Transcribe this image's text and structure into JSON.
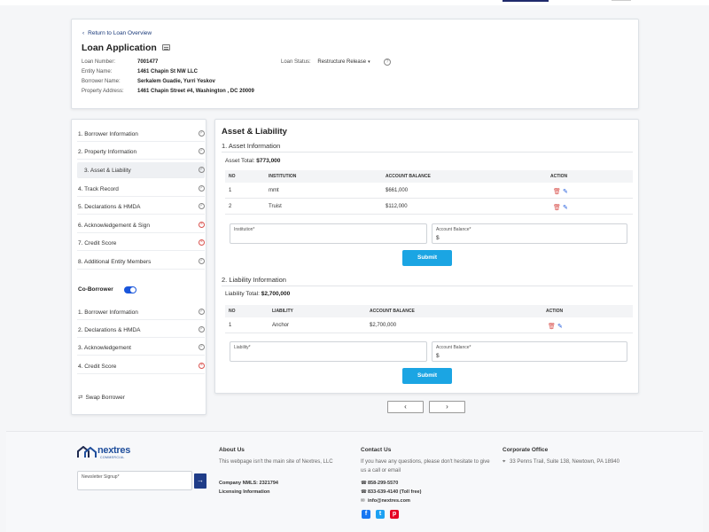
{
  "header": {
    "back_label": "Return to Loan Overview",
    "title": "Loan Application",
    "fields": [
      {
        "label": "Loan Number:",
        "value": "7001477"
      },
      {
        "label": "Entity Name:",
        "value": "1461 Chapin St NW LLC"
      },
      {
        "label": "Borrower Name:",
        "value": "Serkalem Guadie, Yurri Yeskov"
      },
      {
        "label": "Property Address:",
        "value": "1461 Chapin Street #4, Washington , DC 20009"
      }
    ],
    "status_label": "Loan Status:",
    "status_value": "Restructure Release"
  },
  "sidebar": {
    "borrower_steps": [
      {
        "label": "1. Borrower Information",
        "state": "ok"
      },
      {
        "label": "2. Property Information",
        "state": "ok"
      },
      {
        "label": "3. Asset & Liability",
        "state": "ok"
      },
      {
        "label": "4. Track Record",
        "state": "ok"
      },
      {
        "label": "5. Declarations & HMDA",
        "state": "ok"
      },
      {
        "label": "6. Acknowledgement & Sign",
        "state": "err"
      },
      {
        "label": "7. Credit Score",
        "state": "err"
      },
      {
        "label": "8. Additional Entity Members",
        "state": "ok"
      }
    ],
    "coborrower_label": "Co-Borrower",
    "coborrower_steps": [
      {
        "label": "1. Borrower Information",
        "state": "ok"
      },
      {
        "label": "2. Declarations & HMDA",
        "state": "ok"
      },
      {
        "label": "3. Acknowledgement",
        "state": "ok"
      },
      {
        "label": "4. Credit Score",
        "state": "err"
      }
    ],
    "swap_label": "Swap Borrower"
  },
  "main": {
    "title": "Asset & Liability",
    "asset": {
      "title": "1. Asset Information",
      "total_label": "Asset Total:",
      "total_value": "$773,000",
      "columns": [
        "NO",
        "INSTITUTION",
        "ACCOUNT BALANCE",
        "ACTION"
      ],
      "rows": [
        {
          "no": "1",
          "name": "mmt",
          "balance": "$661,000"
        },
        {
          "no": "2",
          "name": "Truist",
          "balance": "$112,000"
        }
      ],
      "field1_label": "Institution*",
      "field2_label": "Account Balance*",
      "field2_value": "$",
      "submit": "Submit"
    },
    "liability": {
      "title": "2. Liability Information",
      "total_label": "Liability Total:",
      "total_value": "$2,700,000",
      "columns": [
        "NO",
        "LIABILITY",
        "ACCOUNT BALANCE",
        "ACTION"
      ],
      "rows": [
        {
          "no": "1",
          "name": "Anchor",
          "balance": "$2,700,000"
        }
      ],
      "field1_label": "Liability*",
      "field2_label": "Account Balance*",
      "field2_value": "$",
      "submit": "Submit"
    }
  },
  "pager": {
    "prev": "‹",
    "next": "›"
  },
  "footer": {
    "logo_name": "nextres",
    "logo_sub": "COMMERCIAL",
    "newsletter_label": "Newsletter Signup*",
    "about_title": "About Us",
    "about_text": "This webpage isn't the main site of Nextres, LLC",
    "nmls": "Company NMLS: 2321794",
    "licensing": "Licensing Information",
    "contact_title": "Contact Us",
    "contact_text": "If you have any questions, please don't hesitate to give us a call or email",
    "phone1": "858-299-5570",
    "phone2": "833-639-4140 (Toll free)",
    "email": "info@nextres.com",
    "office_title": "Corporate Office",
    "office_address": "33 Penns Trail, Suite 138, Newtown, PA 18940"
  },
  "colors": {
    "accent": "#1a56db",
    "submit": "#1ba5e3",
    "brand": "#1f4e9c",
    "error": "#d9534f"
  }
}
